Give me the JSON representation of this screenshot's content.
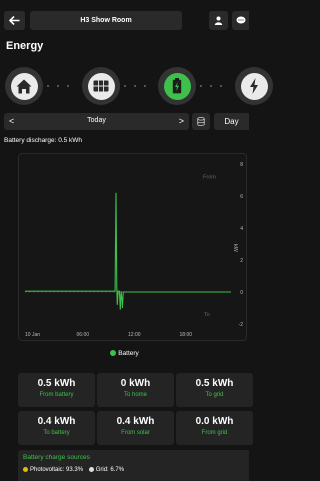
{
  "header": {
    "back_icon": "arrow-left-icon",
    "title": "H3 Show Room",
    "user_icon": "person-icon",
    "chat_icon": "chat-icon"
  },
  "page": {
    "title": "Energy"
  },
  "nav_icons": [
    "home-icon",
    "grid-icon",
    "battery-icon",
    "bolt-icon"
  ],
  "date_nav": {
    "prev": "<",
    "date": "Today",
    "next": ">",
    "db_icon": "database-icon",
    "range": "Day"
  },
  "summary": {
    "battery_discharge": "Battery discharge: 0.5 kWh"
  },
  "chart_data": {
    "type": "line",
    "x_ticks": [
      "10 Jan",
      "06:00",
      "12:00",
      "18:00"
    ],
    "y_ticks": [
      "8",
      "6",
      "4",
      "2",
      "0",
      "-2"
    ],
    "ylabel": "kW",
    "annotations": {
      "from": "From",
      "to": "To"
    },
    "ylim": [
      -2,
      8
    ],
    "series": [
      {
        "name": "Battery",
        "color": "#3ec14a",
        "x": [
          0,
          10.5,
          10.6,
          10.7,
          10.75,
          10.85,
          11.0,
          11.1,
          11.2,
          11.3,
          11.35,
          11.45,
          24
        ],
        "y": [
          0.05,
          0.05,
          6.2,
          0.3,
          -0.8,
          0.05,
          0.05,
          -1.1,
          0.05,
          -0.5,
          -1.0,
          0.0,
          0.0
        ]
      }
    ]
  },
  "legend": {
    "battery": "Battery"
  },
  "stats": [
    {
      "value": "0.5 kWh",
      "label": "From battery"
    },
    {
      "value": "0 kWh",
      "label": "To home"
    },
    {
      "value": "0.5 kWh",
      "label": "To grid"
    },
    {
      "value": "0.4 kWh",
      "label": "To battery"
    },
    {
      "value": "0.4 kWh",
      "label": "From solar"
    },
    {
      "value": "0.0 kWh",
      "label": "From grid"
    }
  ],
  "sources": {
    "title": "Battery charge sources",
    "photovoltaic": "Photovoltaic: 93.3%",
    "grid": "Grid: 6.7%"
  },
  "colors": {
    "accent": "#3ec14a",
    "background": "#141414",
    "card": "#242424"
  }
}
